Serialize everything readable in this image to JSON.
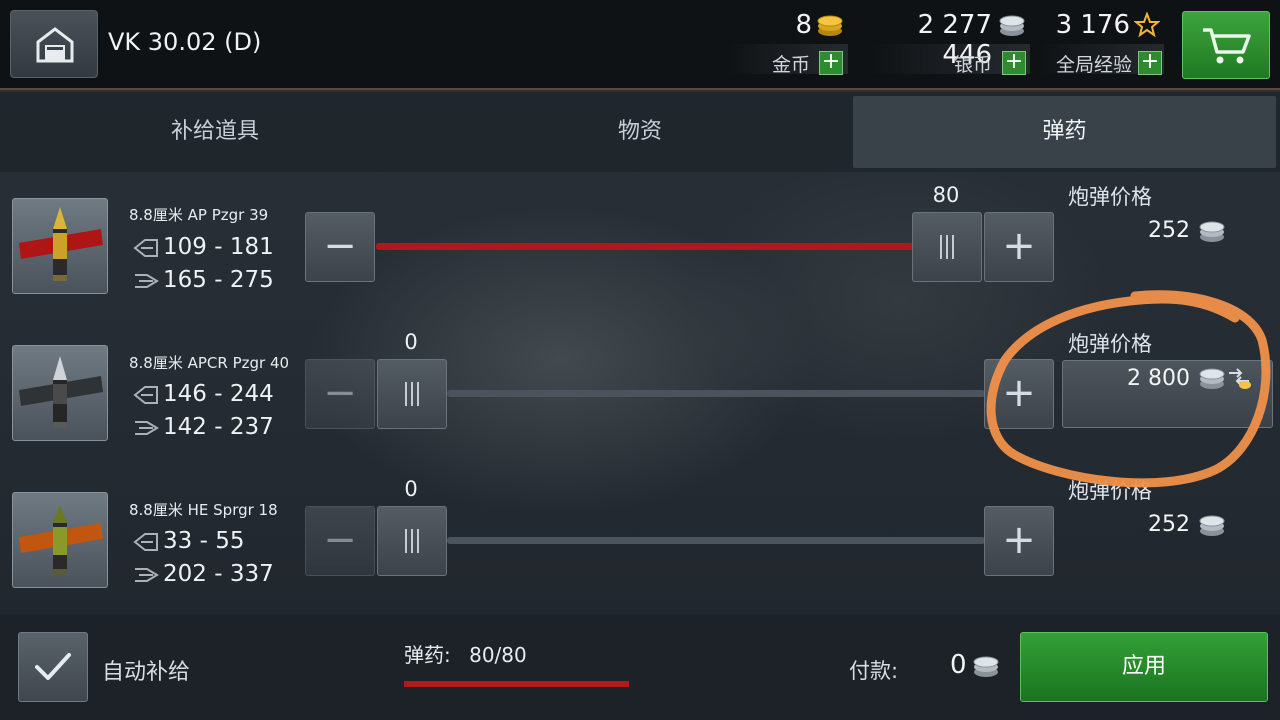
{
  "header": {
    "tank_name": "VK 30.02 (D)",
    "currencies": [
      {
        "amount": "8",
        "label": "金币",
        "icon": "gold-coin-icon"
      },
      {
        "amount": "2 277 446",
        "label": "银币",
        "icon": "silver-coin-icon"
      },
      {
        "amount": "3 176",
        "label": "全局经验",
        "icon": "star-icon"
      }
    ],
    "plus_glyph": "+"
  },
  "tabs": [
    {
      "label": "补给道具",
      "active": false
    },
    {
      "label": "物资",
      "active": false
    },
    {
      "label": "弹药",
      "active": true
    }
  ],
  "shells": [
    {
      "name": "8.8厘米 AP Pzgr 39",
      "penetration": "109 - 181",
      "damage": "165 - 275",
      "count": "80",
      "fill": 1.0,
      "price_label": "炮弹价格",
      "price": "252",
      "price_currency": "silver"
    },
    {
      "name": "8.8厘米 APCR Pzgr 40",
      "penetration": "146 - 244",
      "damage": "142 - 237",
      "count": "0",
      "fill": 0.0,
      "price_label": "炮弹价格",
      "price": "2 800",
      "price_currency": "silver-or-gold"
    },
    {
      "name": "8.8厘米 HE Sprgr 18",
      "penetration": "33 - 55",
      "damage": "202 - 337",
      "count": "0",
      "fill": 0.0,
      "price_label": "炮弹价格",
      "price": "252",
      "price_currency": "silver"
    }
  ],
  "footer": {
    "auto_resupply_label": "自动补给",
    "auto_resupply_checked": true,
    "ammo_label": "弹药:",
    "ammo_value": "80/80",
    "ammo_fraction": 1.0,
    "payment_label": "付款:",
    "payment_value": "0",
    "apply_label": "应用"
  },
  "colors": {
    "accent_green": "#2f8b2f",
    "ammo_red": "#b01a1a",
    "annotation_orange": "#f0904a"
  }
}
